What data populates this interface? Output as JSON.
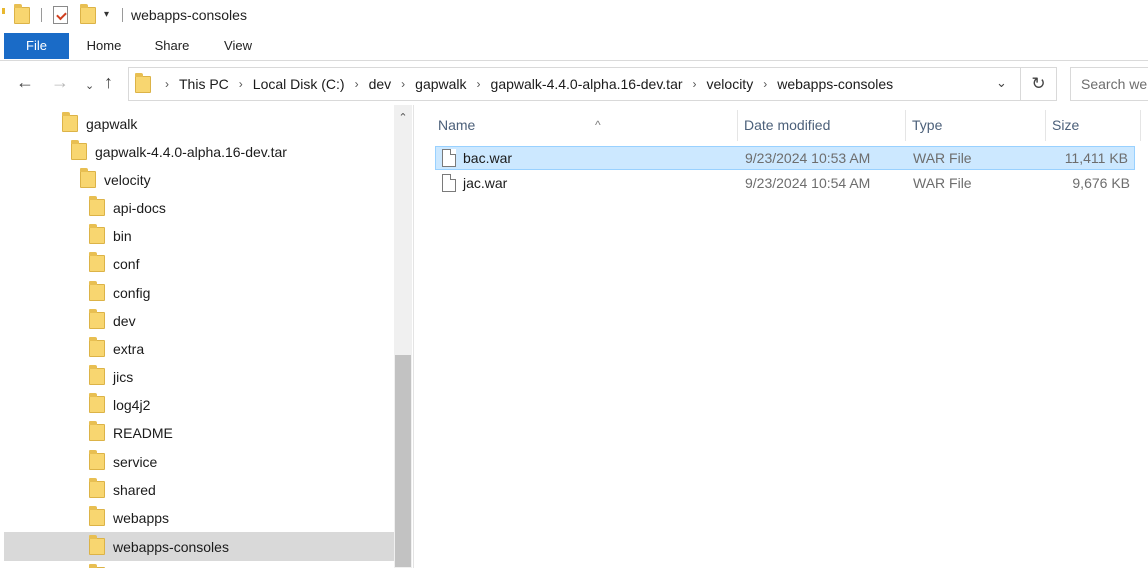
{
  "window": {
    "title": "webapps-consoles",
    "quick_access_dropdown": "▾"
  },
  "ribbon": {
    "tabs": [
      "File",
      "Home",
      "Share",
      "View"
    ]
  },
  "address_bar": {
    "crumbs": [
      "This PC",
      "Local Disk (C:)",
      "dev",
      "gapwalk",
      "gapwalk-4.4.0-alpha.16-dev.tar",
      "velocity",
      "webapps-consoles"
    ],
    "separator": "›",
    "search_placeholder": "Search webapps-consoles"
  },
  "nav_buttons": {
    "back": "←",
    "forward": "→",
    "recent": "⌄",
    "up": "↑",
    "refresh": "↻",
    "dropdown": "⌄"
  },
  "nav_pane": {
    "items": [
      {
        "label": "gapwalk"
      },
      {
        "label": "gapwalk-4.4.0-alpha.16-dev.tar"
      },
      {
        "label": "velocity"
      },
      {
        "label": "api-docs"
      },
      {
        "label": "bin"
      },
      {
        "label": "conf"
      },
      {
        "label": "config"
      },
      {
        "label": "dev"
      },
      {
        "label": "extra"
      },
      {
        "label": "jics"
      },
      {
        "label": "log4j2"
      },
      {
        "label": "README"
      },
      {
        "label": "service"
      },
      {
        "label": "shared"
      },
      {
        "label": "webapps"
      },
      {
        "label": "webapps-consoles",
        "selected": true
      }
    ],
    "scroll_up": "⌃"
  },
  "file_list": {
    "columns": [
      "Name",
      "Date modified",
      "Type",
      "Size"
    ],
    "sort_indicator": "^",
    "files": [
      {
        "name": "bac.war",
        "date_modified": "9/23/2024 10:53 AM",
        "type": "WAR File",
        "size": "11,411 KB",
        "selected": true
      },
      {
        "name": "jac.war",
        "date_modified": "9/23/2024 10:54 AM",
        "type": "WAR File",
        "size": "9,676 KB",
        "selected": false
      }
    ]
  },
  "colors": {
    "file_tab": "#1a6bc7",
    "selected_row": "#cce8ff",
    "selected_tree": "#d9d9d9",
    "folder": "#f8d670"
  }
}
